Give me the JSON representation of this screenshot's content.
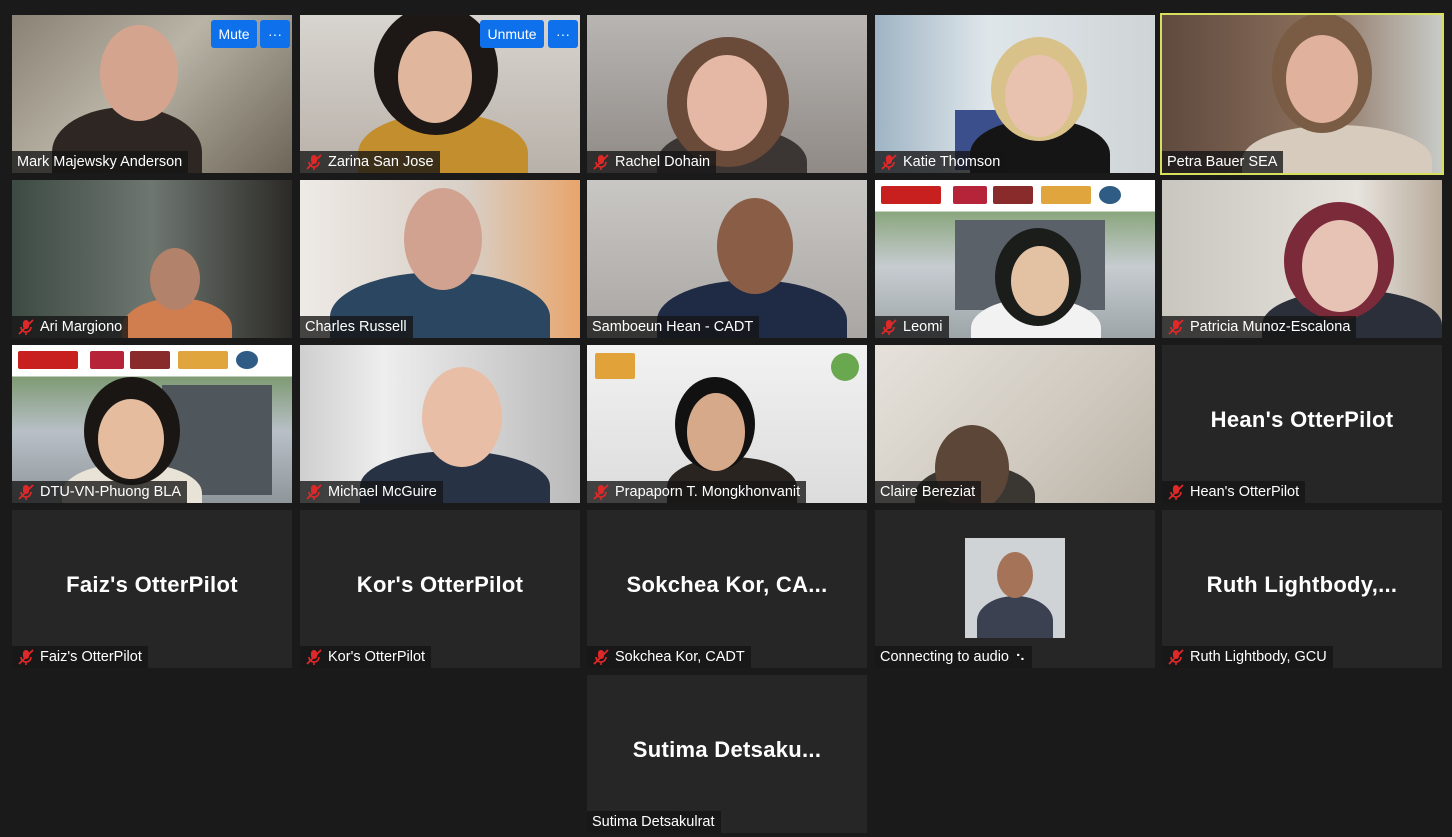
{
  "tile_controls": {
    "mute_label": "Mute",
    "unmute_label": "Unmute",
    "more_label": "···"
  },
  "participants": [
    {
      "name": "Mark Majewsky Anderson",
      "muted": false
    },
    {
      "name": "Zarina San Jose",
      "muted": true
    },
    {
      "name": "Rachel Dohain",
      "muted": true
    },
    {
      "name": "Katie Thomson",
      "muted": true
    },
    {
      "name": "Petra Bauer SEA",
      "muted": false,
      "speaking": true
    },
    {
      "name": "Ari Margiono",
      "muted": true
    },
    {
      "name": "Charles Russell",
      "muted": false
    },
    {
      "name": "Samboeun Hean - CADT",
      "muted": false
    },
    {
      "name": "Leomi",
      "muted": true
    },
    {
      "name": "Patricia Munoz-Escalona",
      "muted": true
    },
    {
      "name": "DTU-VN-Phuong BLA",
      "muted": true
    },
    {
      "name": "Michael McGuire",
      "muted": true
    },
    {
      "name": "Prapaporn T. Mongkhonvanit",
      "muted": true
    },
    {
      "name": "Claire Bereziat",
      "muted": false
    },
    {
      "name": "Hean's OtterPilot",
      "muted": true,
      "display_name": "Hean's OtterPilot"
    },
    {
      "name": "Faiz's OtterPilot",
      "muted": true,
      "display_name": "Faiz's OtterPilot"
    },
    {
      "name": "Kor's OtterPilot",
      "muted": true,
      "display_name": "Kor's OtterPilot"
    },
    {
      "name": "Sokchea Kor, CADT",
      "muted": true,
      "display_name": "Sokchea  Kor,  CA..."
    },
    {
      "name": "Connecting to audio",
      "muted": false,
      "status_glyph": "⠢"
    },
    {
      "name": "Ruth Lightbody, GCU",
      "muted": true,
      "display_name": "Ruth  Lightbody,..."
    },
    {
      "name": "Sutima Detsakulrat",
      "muted": false,
      "display_name": "Sutima  Detsaku..."
    }
  ],
  "colors": {
    "background": "#1a1a1a",
    "tile": "#262626",
    "button": "#0e71eb",
    "speaker_border": "#d7e05c",
    "muted_icon": "#e02828"
  }
}
